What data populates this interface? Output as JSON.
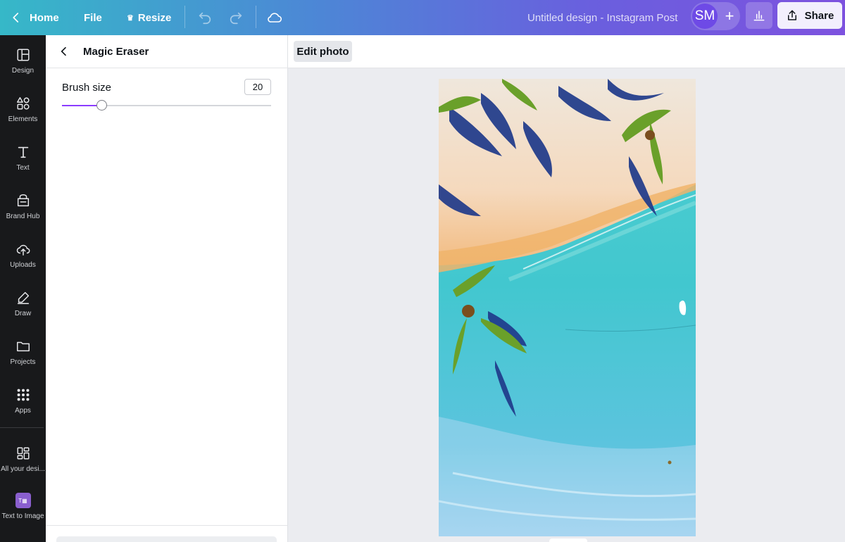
{
  "topbar": {
    "home_label": "Home",
    "file_label": "File",
    "resize_label": "Resize",
    "doc_title": "Untitled design - Instagram Post",
    "avatar_initials": "SM",
    "share_label": "Share"
  },
  "rail": {
    "items": [
      {
        "label": "Design",
        "icon": "layout-icon"
      },
      {
        "label": "Elements",
        "icon": "shapes-icon"
      },
      {
        "label": "Text",
        "icon": "text-icon"
      },
      {
        "label": "Brand Hub",
        "icon": "brand-icon"
      },
      {
        "label": "Uploads",
        "icon": "cloud-upload-icon"
      },
      {
        "label": "Draw",
        "icon": "pen-icon"
      },
      {
        "label": "Projects",
        "icon": "folder-icon"
      },
      {
        "label": "Apps",
        "icon": "grid-icon"
      },
      {
        "label": "All your desi...",
        "icon": "dashboard-icon"
      },
      {
        "label": "Text to Image",
        "icon": "text-to-image-icon"
      }
    ]
  },
  "panel": {
    "title": "Magic Eraser",
    "brush_label": "Brush size",
    "brush_value": "20",
    "brush_level_fraction": 0.19
  },
  "context": {
    "edit_photo_label": "Edit photo"
  },
  "colors": {
    "accent": "#8b3dff",
    "rail_bg": "#18191b",
    "canvas_bg": "#ebecf0"
  }
}
